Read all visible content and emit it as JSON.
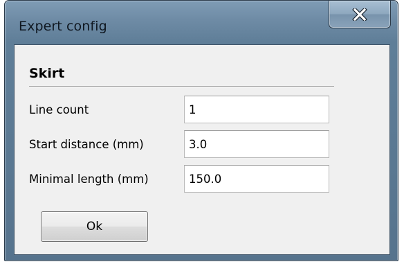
{
  "window": {
    "title": "Expert config",
    "close_icon": "close-x-icon",
    "frame_color": "#6e8ba5"
  },
  "section": {
    "title": "Skirt"
  },
  "fields": [
    {
      "label": "Line count",
      "value": "1"
    },
    {
      "label": "Start distance (mm)",
      "value": "3.0"
    },
    {
      "label": "Minimal length (mm)",
      "value": "150.0"
    }
  ],
  "buttons": {
    "ok_label": "Ok"
  }
}
